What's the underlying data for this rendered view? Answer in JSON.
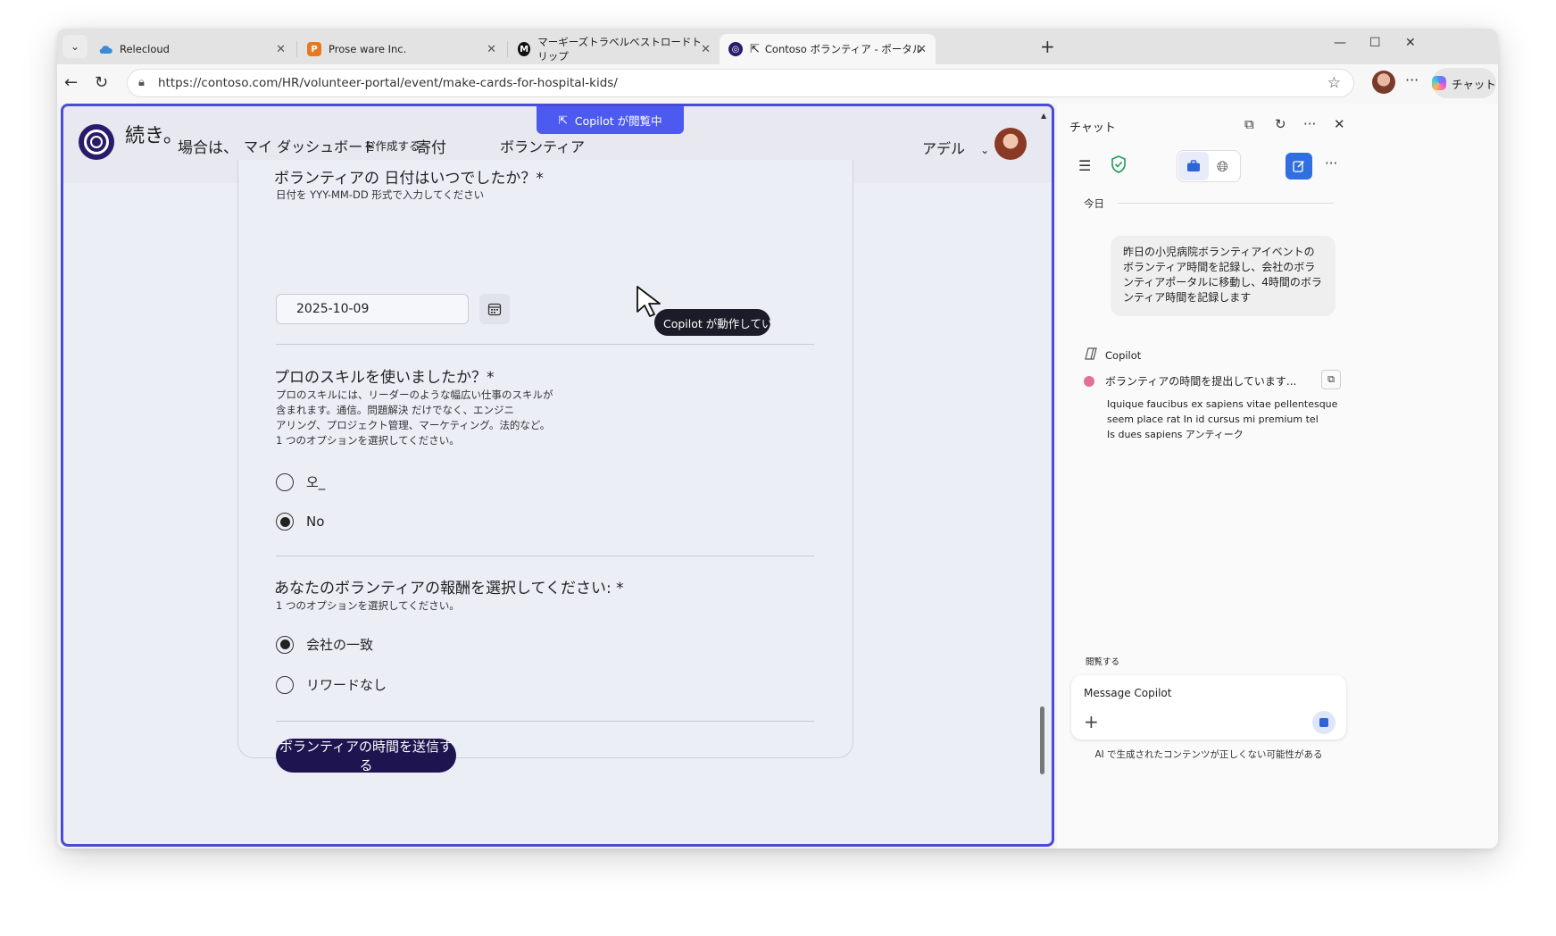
{
  "browser": {
    "tabs": [
      {
        "label": "Relecloud",
        "favicon": "cloud-icon",
        "color": "#3b8ad9"
      },
      {
        "label": "Prose ware Inc.",
        "favicon": "p-icon",
        "color": "#e8781e"
      },
      {
        "label": "マーギーズトラベルベストロードトリップ",
        "favicon": "m-icon",
        "color": "#111111"
      },
      {
        "label": "Contoso ボランティア - ポータル",
        "favicon": "contoso-icon",
        "color": "#2a1a6a"
      }
    ],
    "url": "https://contoso.com/HR/volunteer-portal/event/make-cards-for-hospital-kids/",
    "chat_button": "チャット"
  },
  "site": {
    "name": "続き。",
    "nav": [
      "場合は、",
      "マイ ダッシュボード",
      "を作成する",
      "寄付",
      "ボランティア"
    ],
    "copilot_badge": "Copilot が閲覧中",
    "user_name": "アデル"
  },
  "form": {
    "q_date": {
      "title": "ボランティアの 日付はいつでしたか？*",
      "help": "日付を YYY-MM-DD 形式で入力してください",
      "value": "2025-10-09"
    },
    "q_skills": {
      "title": "プロのスキルを使いましたか？*",
      "help1": "プロのスキルには、リーダーのような幅広い仕事のスキルが",
      "help2": "含まれます。通信。問題解決 だけでなく、エンジニ",
      "help3": "アリング、プロジェクト管理、マーケティング。法的など。",
      "help4": "1 つのオプションを選択してください。",
      "options": [
        {
          "label": "오_",
          "checked": false
        },
        {
          "label": "No",
          "checked": true
        }
      ]
    },
    "q_reward": {
      "title": "あなたのボランティアの報酬を選択してください: *",
      "help": "1 つのオプションを選択してください。",
      "options": [
        {
          "label": "会社の一致",
          "checked": true
        },
        {
          "label": "リワードなし",
          "checked": false
        }
      ]
    },
    "submit": "ボランティアの時間を送信する"
  },
  "overlay": {
    "tooltip": "Copilot が動作していま"
  },
  "chat": {
    "title": "チャット",
    "today": "今日",
    "user_message": "昨日の小児病院ボランティアイベントのボランティア時間を記録し、会社のボランティアポータルに移動し、4時間のボランティア時間を記録します",
    "copilot_label": "Copilot",
    "status": "ボランティアの時間を提出しています...",
    "detail_line1": "Iquique faucibus ex sapiens vitae pellentesque",
    "detail_line2": "seem place rat In id cursus mi premium tel",
    "detail_line3": "Is dues sapiens アンティーク",
    "browse_label": "閲覧する",
    "input_placeholder": "Message Copilot",
    "disclaimer": "AI で生成されたコンテンツが正しくない可能性がある"
  }
}
